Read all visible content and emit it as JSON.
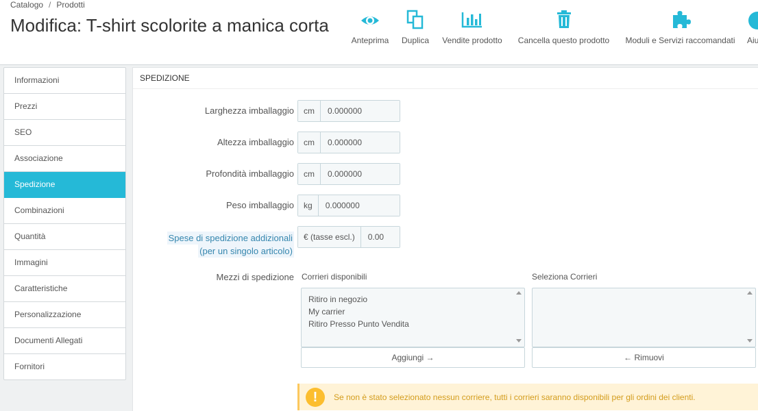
{
  "breadcrumb": [
    "Catalogo",
    "/",
    "Prodotti"
  ],
  "title": "Modifica: T-shirt scolorite a manica corta",
  "toolbar": [
    {
      "label": "Anteprima",
      "icon": "eye-icon"
    },
    {
      "label": "Duplica",
      "icon": "copy-icon"
    },
    {
      "label": "Vendite prodotto",
      "icon": "bar-chart-icon"
    },
    {
      "label": "Cancella questo prodotto",
      "icon": "trash-icon"
    },
    {
      "label": "Moduli e Servizi raccomandati",
      "icon": "puzzle-icon"
    },
    {
      "label": "Aiu",
      "icon": "help-icon"
    }
  ],
  "sidebar": [
    {
      "label": "Informazioni"
    },
    {
      "label": "Prezzi"
    },
    {
      "label": "SEO"
    },
    {
      "label": "Associazione"
    },
    {
      "label": "Spedizione",
      "active": true
    },
    {
      "label": "Combinazioni"
    },
    {
      "label": "Quantità"
    },
    {
      "label": "Immagini"
    },
    {
      "label": "Caratteristiche"
    },
    {
      "label": "Personalizzazione"
    },
    {
      "label": "Documenti Allegati"
    },
    {
      "label": "Fornitori"
    }
  ],
  "panel": {
    "heading": "Spedizione",
    "fields": [
      {
        "label": "Larghezza imballaggio",
        "addon": "cm",
        "value": "0.000000"
      },
      {
        "label": "Altezza imballaggio",
        "addon": "cm",
        "value": "0.000000"
      },
      {
        "label": "Profondità imballaggio",
        "addon": "cm",
        "value": "0.000000"
      },
      {
        "label": "Peso imballaggio",
        "addon": "kg",
        "value": "0.000000"
      }
    ],
    "extra_cost": {
      "label_line1": "Spese di spedizione addizionali",
      "label_line2": "(per un singolo articolo)",
      "addon": "€ (tasse escl.)",
      "value": "0.00"
    },
    "carriers": {
      "label": "Mezzi di spedizione",
      "available_title": "Corrieri disponibili",
      "selected_title": "Seleziona Corrieri",
      "available": [
        "Ritiro in negozio",
        "My carrier",
        "Ritiro Presso Punto Vendita"
      ],
      "add_label": "Aggiungi",
      "remove_label": "Rimuovi"
    },
    "alert": "Se non è stato selezionato nessun corriere, tutti i corrieri saranno disponibili per gli ordini dei clienti."
  },
  "colors": {
    "accent": "#25b9d7",
    "icon": "#25b9d7",
    "alert_bg": "#fff3d7",
    "alert_text": "#d39c1c"
  }
}
